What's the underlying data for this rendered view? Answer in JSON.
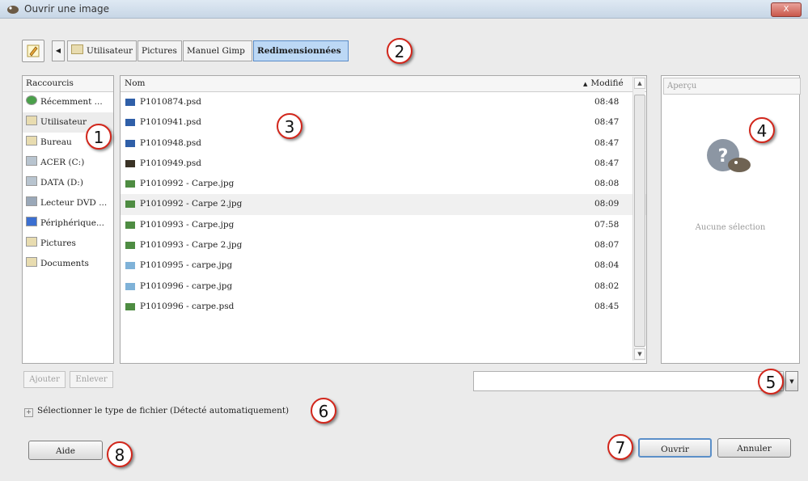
{
  "window": {
    "title": "Ouvrir une image",
    "close_label": "X"
  },
  "pathbar": {
    "crumbs": [
      {
        "label": "Utilisateur",
        "active": false
      },
      {
        "label": "Pictures",
        "active": false
      },
      {
        "label": "Manuel Gimp",
        "active": false
      },
      {
        "label": "Redimensionnées",
        "active": true
      }
    ]
  },
  "shortcuts": {
    "header": "Raccourcis",
    "items": [
      {
        "label": "Récemment ...",
        "icon": "recent-icon"
      },
      {
        "label": "Utilisateur",
        "icon": "folder-icon"
      },
      {
        "label": "Bureau",
        "icon": "folder-icon"
      },
      {
        "label": "ACER (C:)",
        "icon": "drive-icon"
      },
      {
        "label": "DATA (D:)",
        "icon": "drive-icon"
      },
      {
        "label": "Lecteur DVD ...",
        "icon": "dvd-icon"
      },
      {
        "label": "Périphérique...",
        "icon": "usb-icon"
      },
      {
        "label": "Pictures",
        "icon": "folder-icon"
      },
      {
        "label": "Documents",
        "icon": "folder-icon"
      }
    ],
    "add_label": "Ajouter",
    "remove_label": "Enlever"
  },
  "files": {
    "col_name": "Nom",
    "col_modified": "Modifié",
    "rows": [
      {
        "name": "P1010874.psd",
        "time": "08:48",
        "kind": "psd"
      },
      {
        "name": "P1010941.psd",
        "time": "08:47",
        "kind": "psd"
      },
      {
        "name": "P1010948.psd",
        "time": "08:47",
        "kind": "psd"
      },
      {
        "name": "P1010949.psd",
        "time": "08:47",
        "kind": "psd-dark"
      },
      {
        "name": "P1010992 - Carpe.jpg",
        "time": "08:08",
        "kind": "jpg"
      },
      {
        "name": "P1010992 - Carpe 2.jpg",
        "time": "08:09",
        "kind": "jpg"
      },
      {
        "name": "P1010993 - Carpe.jpg",
        "time": "07:58",
        "kind": "jpg"
      },
      {
        "name": "P1010993 - Carpe 2.jpg",
        "time": "08:07",
        "kind": "jpg"
      },
      {
        "name": "P1010995 - carpe.jpg",
        "time": "08:04",
        "kind": "img"
      },
      {
        "name": "P1010996 - carpe.jpg",
        "time": "08:02",
        "kind": "img"
      },
      {
        "name": "P1010996 - carpe.psd",
        "time": "08:45",
        "kind": "jpg"
      }
    ]
  },
  "preview": {
    "header": "Aperçu",
    "empty_text": "Aucune sélection"
  },
  "filetype_label": "Sélectionner le type de fichier (Détecté automatiquement)",
  "buttons": {
    "help": "Aide",
    "open": "Ouvrir",
    "cancel": "Annuler"
  },
  "callouts": [
    "1",
    "2",
    "3",
    "4",
    "5",
    "6",
    "7",
    "8"
  ],
  "colors": {
    "accent": "#bcd8f5",
    "callout_border": "#d2261b"
  }
}
